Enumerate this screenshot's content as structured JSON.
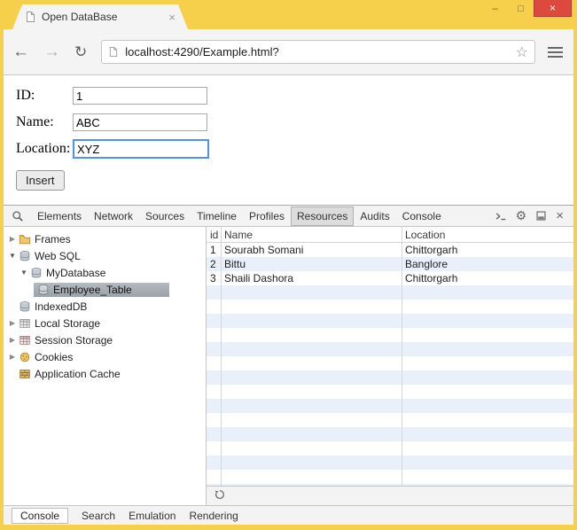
{
  "colors": {
    "frame": "#f6d04b",
    "close_button": "#dc4a3e",
    "row_stripe": "#e9f0fb",
    "selection": "#a3abb4",
    "focus_ring": "#4d90fe"
  },
  "icons": {
    "collapsed_arrow": "▶",
    "expanded_arrow": "▼",
    "back": "←",
    "forward": "→",
    "refresh": "↻",
    "star": "☆",
    "gear": "⚙",
    "close": "×",
    "minimize": "–",
    "maximize": "□"
  },
  "window": {
    "tab_title": "Open DataBase"
  },
  "browser": {
    "url": "localhost:4290/Example.html?"
  },
  "page": {
    "fields": [
      {
        "label": "ID:",
        "value": "1"
      },
      {
        "label": "Name:",
        "value": "ABC"
      },
      {
        "label": "Location:",
        "value": "XYZ"
      }
    ],
    "insert_button": "Insert"
  },
  "devtools": {
    "tabs": [
      "Elements",
      "Network",
      "Sources",
      "Timeline",
      "Profiles",
      "Resources",
      "Audits",
      "Console"
    ],
    "selected_tab": "Resources",
    "sidebar": [
      {
        "label": "Frames"
      },
      {
        "label": "Web SQL"
      },
      {
        "label": "MyDatabase"
      },
      {
        "label": "Employee_Table"
      },
      {
        "label": "IndexedDB"
      },
      {
        "label": "Local Storage"
      },
      {
        "label": "Session Storage"
      },
      {
        "label": "Cookies"
      },
      {
        "label": "Application Cache"
      }
    ],
    "selected_sidebar_item": "Employee_Table",
    "grid": {
      "columns": [
        "id",
        "Name",
        "Location"
      ],
      "rows": [
        [
          "1",
          "Sourabh Somani",
          "Chittorgarh"
        ],
        [
          "2",
          "Bittu",
          "Banglore"
        ],
        [
          "3",
          "Shaili Dashora",
          "Chittorgarh"
        ]
      ]
    },
    "bottom_tabs": [
      "Console",
      "Search",
      "Emulation",
      "Rendering"
    ],
    "selected_bottom_tab": "Console"
  }
}
